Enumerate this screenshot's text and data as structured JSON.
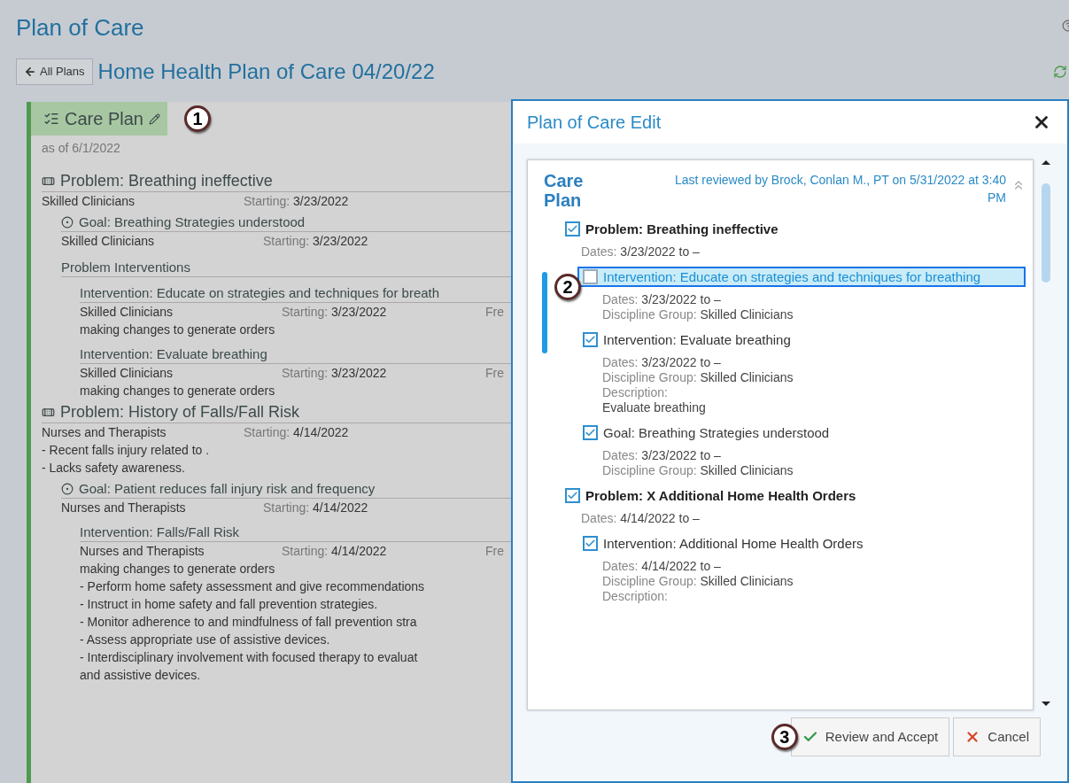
{
  "page": {
    "title": "Plan of Care",
    "back_button": "All Plans",
    "plan_title": "Home Health Plan of Care 04/20/22"
  },
  "care_plan": {
    "title": "Care Plan",
    "as_of": "as of 6/1/2022",
    "problems": [
      {
        "title": "Problem: Breathing ineffective",
        "group": "Skilled Clinicians",
        "starting_label": "Starting:",
        "starting": "3/23/2022",
        "goals": [
          {
            "title": "Goal: Breathing Strategies understood",
            "group": "Skilled Clinicians",
            "starting_label": "Starting:",
            "starting": "3/23/2022"
          }
        ],
        "section_label": "Problem Interventions",
        "interventions": [
          {
            "title": "Intervention: Educate on strategies and techniques for breath",
            "group": "Skilled Clinicians",
            "starting_label": "Starting:",
            "starting": "3/23/2022",
            "column_3": "Fre",
            "lines": [
              "making changes to generate orders"
            ]
          },
          {
            "title": "Intervention: Evaluate breathing",
            "group": "Skilled Clinicians",
            "starting_label": "Starting:",
            "starting": "3/23/2022",
            "column_3": "Fre",
            "lines": [
              "making changes to generate orders"
            ]
          }
        ]
      },
      {
        "title": "Problem: History of Falls/Fall Risk",
        "group": "Nurses and Therapists",
        "starting_label": "Starting:",
        "starting": "4/14/2022",
        "notes": [
          "- Recent falls  injury related to .",
          "- Lacks safety awareness."
        ],
        "goals": [
          {
            "title": "Goal: Patient reduces fall injury risk and frequency",
            "group": "Nurses and Therapists",
            "starting_label": "Starting:",
            "starting": "4/14/2022"
          }
        ],
        "interventions": [
          {
            "title": "Intervention: Falls/Fall Risk",
            "group": "Nurses and Therapists",
            "starting_label": "Starting:",
            "starting": "4/14/2022",
            "column_3": "Fre",
            "lines": [
              "making changes to generate orders",
              "- Perform home safety assessment and give recommendations",
              "- Instruct in home safety and fall prevention strategies.",
              "- Monitor adherence to and mindfulness of fall prevention stra",
              "- Assess appropriate use of assistive devices.",
              "- Interdisciplinary involvement with focused therapy to evaluat",
              "and assistive devices."
            ]
          }
        ]
      }
    ]
  },
  "modal": {
    "title": "Plan of Care Edit",
    "heading": "Care Plan",
    "last_reviewed": "Last reviewed by Brock, Conlan M., PT on 5/31/2022 at 3:40 PM",
    "items": [
      {
        "kind": "problem",
        "title": "Problem: Breathing ineffective",
        "checked": true,
        "selected": false,
        "dates_label": "Dates:",
        "dates": "3/23/2022 to –",
        "children": [
          {
            "kind": "intervention",
            "title": "Intervention: Educate on strategies and techniques for breathing",
            "checked": false,
            "selected": true,
            "dates_label": "Dates:",
            "dates": "3/23/2022 to –",
            "discipline_label": "Discipline Group:",
            "discipline": "Skilled Clinicians"
          },
          {
            "kind": "intervention",
            "title": "Intervention: Evaluate breathing",
            "checked": true,
            "selected": false,
            "dates_label": "Dates:",
            "dates": "3/23/2022 to –",
            "discipline_label": "Discipline Group:",
            "discipline": "Skilled Clinicians",
            "description_label": "Description:",
            "description": "Evaluate breathing"
          },
          {
            "kind": "goal",
            "title": "Goal: Breathing Strategies understood",
            "checked": true,
            "selected": false,
            "dates_label": "Dates:",
            "dates": "3/23/2022 to –",
            "discipline_label": "Discipline Group:",
            "discipline": "Skilled Clinicians"
          }
        ]
      },
      {
        "kind": "problem",
        "title": "Problem: X Additional Home Health Orders",
        "checked": true,
        "selected": false,
        "dates_label": "Dates:",
        "dates": "4/14/2022 to –",
        "children": [
          {
            "kind": "intervention",
            "title": "Intervention: Additional Home Health Orders",
            "checked": true,
            "selected": false,
            "dates_label": "Dates:",
            "dates": "4/14/2022 to –",
            "discipline_label": "Discipline Group:",
            "discipline": "Skilled Clinicians",
            "description_label": "Description:"
          }
        ]
      }
    ],
    "buttons": [
      {
        "kind": "accept",
        "label": "Review and Accept"
      },
      {
        "kind": "cancel",
        "label": "Cancel"
      }
    ]
  },
  "callouts": [
    "1",
    "2",
    "3"
  ]
}
